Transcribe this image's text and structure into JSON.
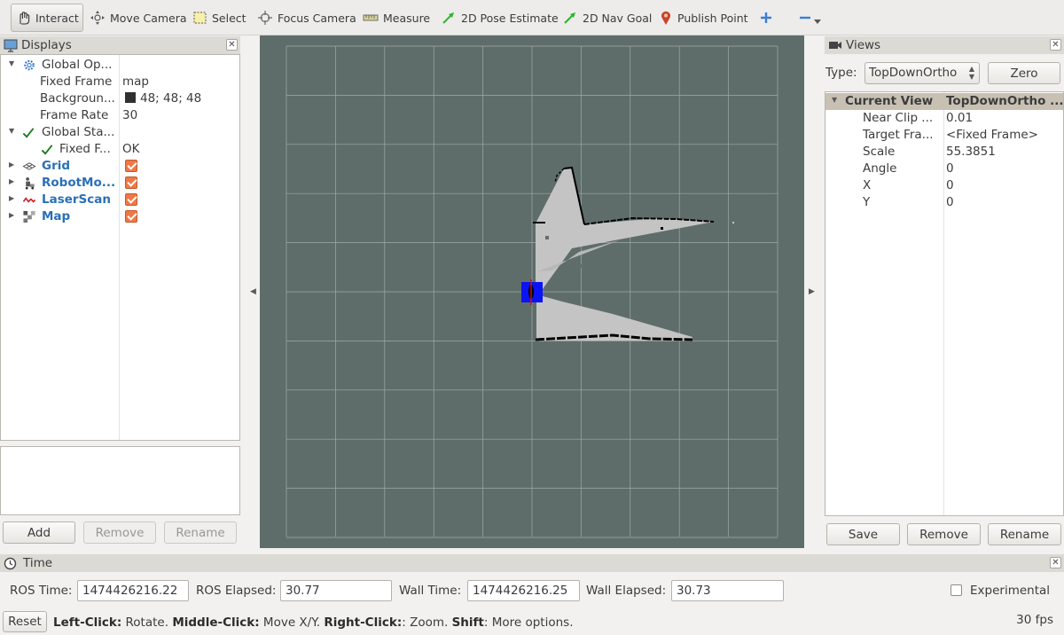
{
  "toolbar": {
    "tools": [
      {
        "label": "Interact",
        "icon": "hand-pointer-icon",
        "active": true
      },
      {
        "label": "Move Camera",
        "icon": "move-camera-icon"
      },
      {
        "label": "Select",
        "icon": "select-box-icon"
      },
      {
        "label": "Focus Camera",
        "icon": "focus-crosshair-icon"
      },
      {
        "label": "Measure",
        "icon": "ruler-icon"
      },
      {
        "label": "2D Pose Estimate",
        "icon": "green-arrow-icon"
      },
      {
        "label": "2D Nav Goal",
        "icon": "green-arrow-icon"
      },
      {
        "label": "Publish Point",
        "icon": "red-pin-icon"
      }
    ],
    "plus_icon": "plus-icon",
    "minus_icon": "minus-icon"
  },
  "displays": {
    "title": "Displays",
    "rows": [
      {
        "label": "Global Op...",
        "value": ""
      },
      {
        "label": "Fixed Frame",
        "value": "map"
      },
      {
        "label": "Backgroun...",
        "value": "48; 48; 48"
      },
      {
        "label": "Frame Rate",
        "value": "30"
      },
      {
        "label": "Global Sta...",
        "value": ""
      },
      {
        "label": "Fixed F...",
        "value": "OK"
      },
      {
        "label": "Grid",
        "checked": true
      },
      {
        "label": "RobotMo...",
        "checked": true
      },
      {
        "label": "LaserScan",
        "checked": true
      },
      {
        "label": "Map",
        "checked": true
      }
    ],
    "buttons": {
      "add": "Add",
      "remove": "Remove",
      "rename": "Rename"
    }
  },
  "views": {
    "title": "Views",
    "type_label": "Type:",
    "type_value": "TopDownOrtho",
    "zero_button": "Zero",
    "header": {
      "label": "Current View",
      "value": "TopDownOrtho ..."
    },
    "rows": [
      {
        "label": "Near Clip ...",
        "value": "0.01"
      },
      {
        "label": "Target Fra...",
        "value": "<Fixed Frame>"
      },
      {
        "label": "Scale",
        "value": "55.3851"
      },
      {
        "label": "Angle",
        "value": "0"
      },
      {
        "label": "X",
        "value": "0"
      },
      {
        "label": "Y",
        "value": "0"
      }
    ],
    "buttons": {
      "save": "Save",
      "remove": "Remove",
      "rename": "Rename"
    }
  },
  "time": {
    "title": "Time",
    "ros_time_label": "ROS Time:",
    "ros_time": "1474426216.22",
    "ros_elapsed_label": "ROS Elapsed:",
    "ros_elapsed": "30.77",
    "wall_time_label": "Wall Time:",
    "wall_time": "1474426216.25",
    "wall_elapsed_label": "Wall Elapsed:",
    "wall_elapsed": "30.73",
    "experimental_label": "Experimental",
    "experimental_checked": false
  },
  "status": {
    "reset_button": "Reset",
    "hint_parts": [
      {
        "bold": "Left-Click:",
        "text": " Rotate. "
      },
      {
        "bold": "Middle-Click:",
        "text": " Move X/Y. "
      },
      {
        "bold": "Right-Click:",
        "text": ": Zoom. "
      },
      {
        "bold": "Shift",
        "text": ": More options."
      }
    ],
    "fps": "30 fps"
  },
  "colors": {
    "viewport_background": "#5f6d6a",
    "grid_line": "#a0aaa7",
    "free_space": "#c4c4c4",
    "obstacle": "#000000",
    "robot_body": "#0a14f5",
    "laser_scan": "#d01010",
    "display_name_blue": "#2a6fb8",
    "checkbox_orange": "#f07746"
  }
}
